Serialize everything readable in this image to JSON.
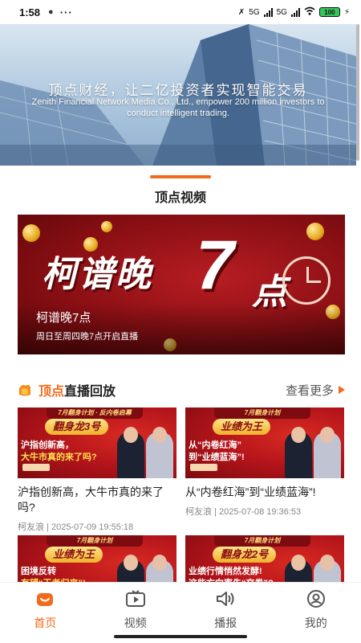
{
  "status_bar": {
    "time": "1:58",
    "network_labels": [
      "5G",
      "5G"
    ],
    "battery": "100"
  },
  "hero": {
    "title": "顶点财经，让二亿投资者实现智能交易",
    "subtitle": "Zenith Financial Network Media Co., Ltd., empower 200 million investors to conduct intelligent trading."
  },
  "video_section": {
    "title": "顶点视频",
    "accent_color": "#f26a1b"
  },
  "banner": {
    "big_text_a": "柯谱晚",
    "big_text_b": "7",
    "big_text_c": "点",
    "name": "柯谱晚7点",
    "desc": "周日至周四晚7点开启直播"
  },
  "replay_section": {
    "title_accent": "顶点",
    "title_rest": "直播回放",
    "more_label": "查看更多"
  },
  "videos": [
    {
      "thumb_top": "7月翻身计划 · 反内卷启幕",
      "thumb_badge": "翻身龙3号",
      "thumb_line1": "沪指创新高，",
      "thumb_line2": "大牛市真的来了吗?",
      "title": "沪指创新高，大牛市真的来了吗?",
      "meta": "柯友浪 | 2025-07-09 19:55:18"
    },
    {
      "thumb_top": "7月翻身计划",
      "thumb_badge": "业绩为王",
      "thumb_line1": "从“内卷红海”",
      "thumb_line2": "到“业绩蓝海”!",
      "title": "从“内卷红海”到“业绩蓝海”!",
      "meta": "柯友浪 | 2025-07-08 19:36:53"
    },
    {
      "thumb_top": "7月翻身计划",
      "thumb_badge": "业绩为王",
      "thumb_line1": "困境反转",
      "thumb_line2": "有望“王者归来”!"
    },
    {
      "thumb_top": "7月翻身计划",
      "thumb_badge": "翻身龙2号",
      "thumb_line1": "业绩行情悄然发酵!",
      "thumb_line2": "这些方向率先“交卷”?"
    }
  ],
  "bottom_nav": [
    {
      "label": "首页",
      "icon": "home-icon",
      "active": true
    },
    {
      "label": "视频",
      "icon": "video-icon",
      "active": false
    },
    {
      "label": "播报",
      "icon": "speaker-icon",
      "active": false
    },
    {
      "label": "我的",
      "icon": "profile-icon",
      "active": false
    }
  ]
}
